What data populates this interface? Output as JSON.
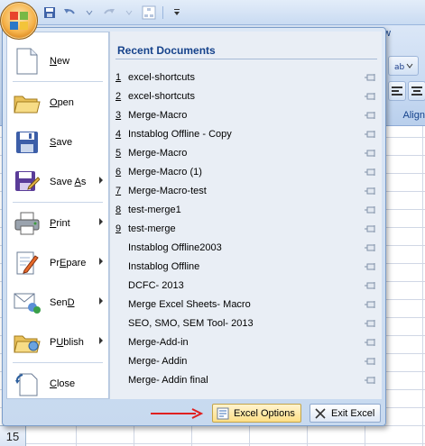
{
  "ribbon": {
    "tab_partial": "w",
    "group_label_partial": "Align"
  },
  "menu": {
    "commands": [
      {
        "label": "New",
        "mnemonic": "N",
        "rest": "ew",
        "has_arrow": false
      },
      {
        "label": "Open",
        "mnemonic": "O",
        "rest": "pen",
        "has_arrow": false
      },
      {
        "label": "Save",
        "mnemonic": "S",
        "rest": "ave",
        "has_arrow": false
      },
      {
        "label": "Save As",
        "mnemonic": "A",
        "rest": "",
        "has_arrow": true
      },
      {
        "label": "Print",
        "mnemonic": "P",
        "rest": "rint",
        "has_arrow": true
      },
      {
        "label": "Prepare",
        "mnemonic": "E",
        "rest": "",
        "has_arrow": true
      },
      {
        "label": "Send",
        "mnemonic": "D",
        "rest": "",
        "has_arrow": true
      },
      {
        "label": "Publish",
        "mnemonic": "U",
        "rest": "",
        "has_arrow": true
      },
      {
        "label": "Close",
        "mnemonic": "C",
        "rest": "lose",
        "has_arrow": false
      }
    ],
    "recent_title": "Recent Documents",
    "recent": [
      {
        "num": "1",
        "name": "excel-shortcuts"
      },
      {
        "num": "2",
        "name": "excel-shortcuts"
      },
      {
        "num": "3",
        "name": "Merge-Macro"
      },
      {
        "num": "4",
        "name": "Instablog Offline - Copy"
      },
      {
        "num": "5",
        "name": "Merge-Macro"
      },
      {
        "num": "6",
        "name": "Merge-Macro (1)"
      },
      {
        "num": "7",
        "name": "Merge-Macro-test"
      },
      {
        "num": "8",
        "name": "test-merge1"
      },
      {
        "num": "9",
        "name": "test-merge"
      },
      {
        "num": "",
        "name": "Instablog Offline2003"
      },
      {
        "num": "",
        "name": "Instablog Offline"
      },
      {
        "num": "",
        "name": "DCFC- 2013"
      },
      {
        "num": "",
        "name": "Merge Excel Sheets- Macro"
      },
      {
        "num": "",
        "name": "SEO, SMO, SEM Tool- 2013"
      },
      {
        "num": "",
        "name": "Merge-Add-in"
      },
      {
        "num": "",
        "name": "Merge- Addin"
      },
      {
        "num": "",
        "name": "Merge- Addin final"
      }
    ],
    "options_label": "Excel Options",
    "exit_label": "Exit Excel"
  },
  "grid": {
    "row_number": "15"
  },
  "colors": {
    "accent": "#15428b",
    "arrow": "#e02020"
  }
}
